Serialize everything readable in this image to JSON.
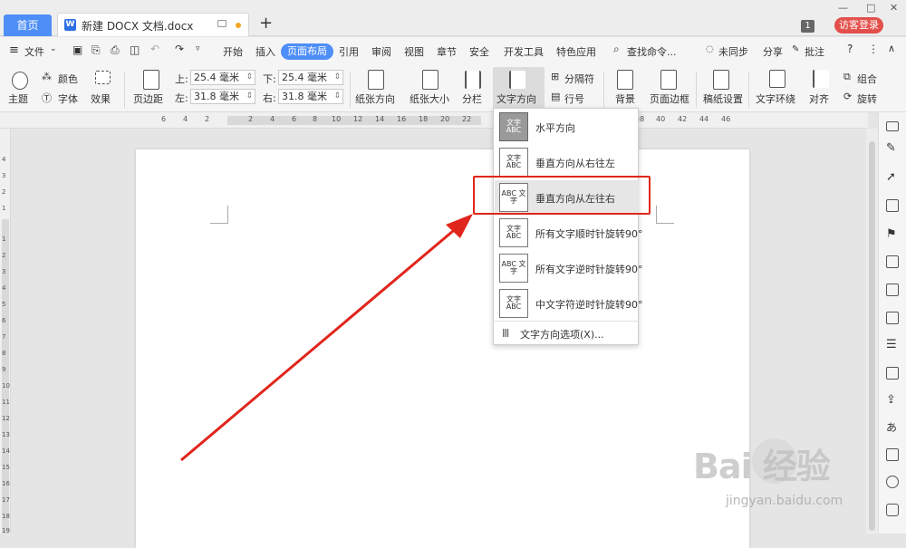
{
  "tabs": {
    "home": "首页",
    "document": "新建 DOCX 文档.docx",
    "new_tab": "+"
  },
  "window": {
    "badge": "1",
    "visitor_login": "访客登录",
    "minimize": "—",
    "maximize": "□",
    "close": "✕"
  },
  "menu": {
    "file": "文件",
    "items": [
      "开始",
      "插入",
      "页面布局",
      "引用",
      "审阅",
      "视图",
      "章节",
      "安全",
      "开发工具",
      "特色应用"
    ],
    "search": "查找命令...",
    "unsync": "未同步",
    "share": "分享",
    "annotate": "批注"
  },
  "toolbar": {
    "theme": "主题",
    "color": "颜色",
    "font": "字体",
    "effect": "效果",
    "margin": "页边距",
    "top_label": "上:",
    "top_value": "25.4 毫米",
    "bottom_label": "下:",
    "bottom_value": "25.4 毫米",
    "left_label": "左:",
    "left_value": "31.8 毫米",
    "right_label": "右:",
    "right_value": "31.8 毫米",
    "orientation": "纸张方向",
    "size": "纸张大小",
    "columns": "分栏",
    "text_direction": "文字方向",
    "separator": "分隔符",
    "line_number": "行号",
    "background": "背景",
    "page_border": "页面边框",
    "draft_setting": "稿纸设置",
    "text_wrap": "文字环绕",
    "align": "对齐",
    "group": "组合",
    "rotate": "旋转"
  },
  "ruler": {
    "numbers": [
      "6",
      "4",
      "2",
      "2",
      "4",
      "6",
      "8",
      "10",
      "12",
      "14",
      "16",
      "18",
      "20",
      "22",
      "24",
      "38",
      "40",
      "42",
      "44",
      "46"
    ]
  },
  "vruler": {
    "numbers": [
      "4",
      "3",
      "2",
      "1",
      "1",
      "2",
      "3",
      "4",
      "5",
      "6",
      "7",
      "8",
      "9",
      "10",
      "11",
      "12",
      "13",
      "14",
      "15",
      "16",
      "17",
      "18",
      "19"
    ]
  },
  "dropdown": {
    "items": [
      {
        "icon": "文字 ABC",
        "label": "水平方向"
      },
      {
        "icon": "文字 ABC",
        "label": "垂直方向从右往左"
      },
      {
        "icon": "ABC 文字",
        "label": "垂直方向从左往右"
      },
      {
        "icon": "文字 ABC",
        "label": "所有文字顺时针旋转90°"
      },
      {
        "icon": "ABC 文字",
        "label": "所有文字逆时针旋转90°"
      },
      {
        "icon": "文字 ABC",
        "label": "中文字符逆时针旋转90°"
      }
    ],
    "options": "文字方向选项(X)..."
  },
  "watermark": {
    "brand": "Bai 经验",
    "url": "jingyan.baidu.com"
  },
  "colors": {
    "accent": "#4e8ef7",
    "highlight": "#e0261c",
    "arrow": "#e0261c"
  }
}
